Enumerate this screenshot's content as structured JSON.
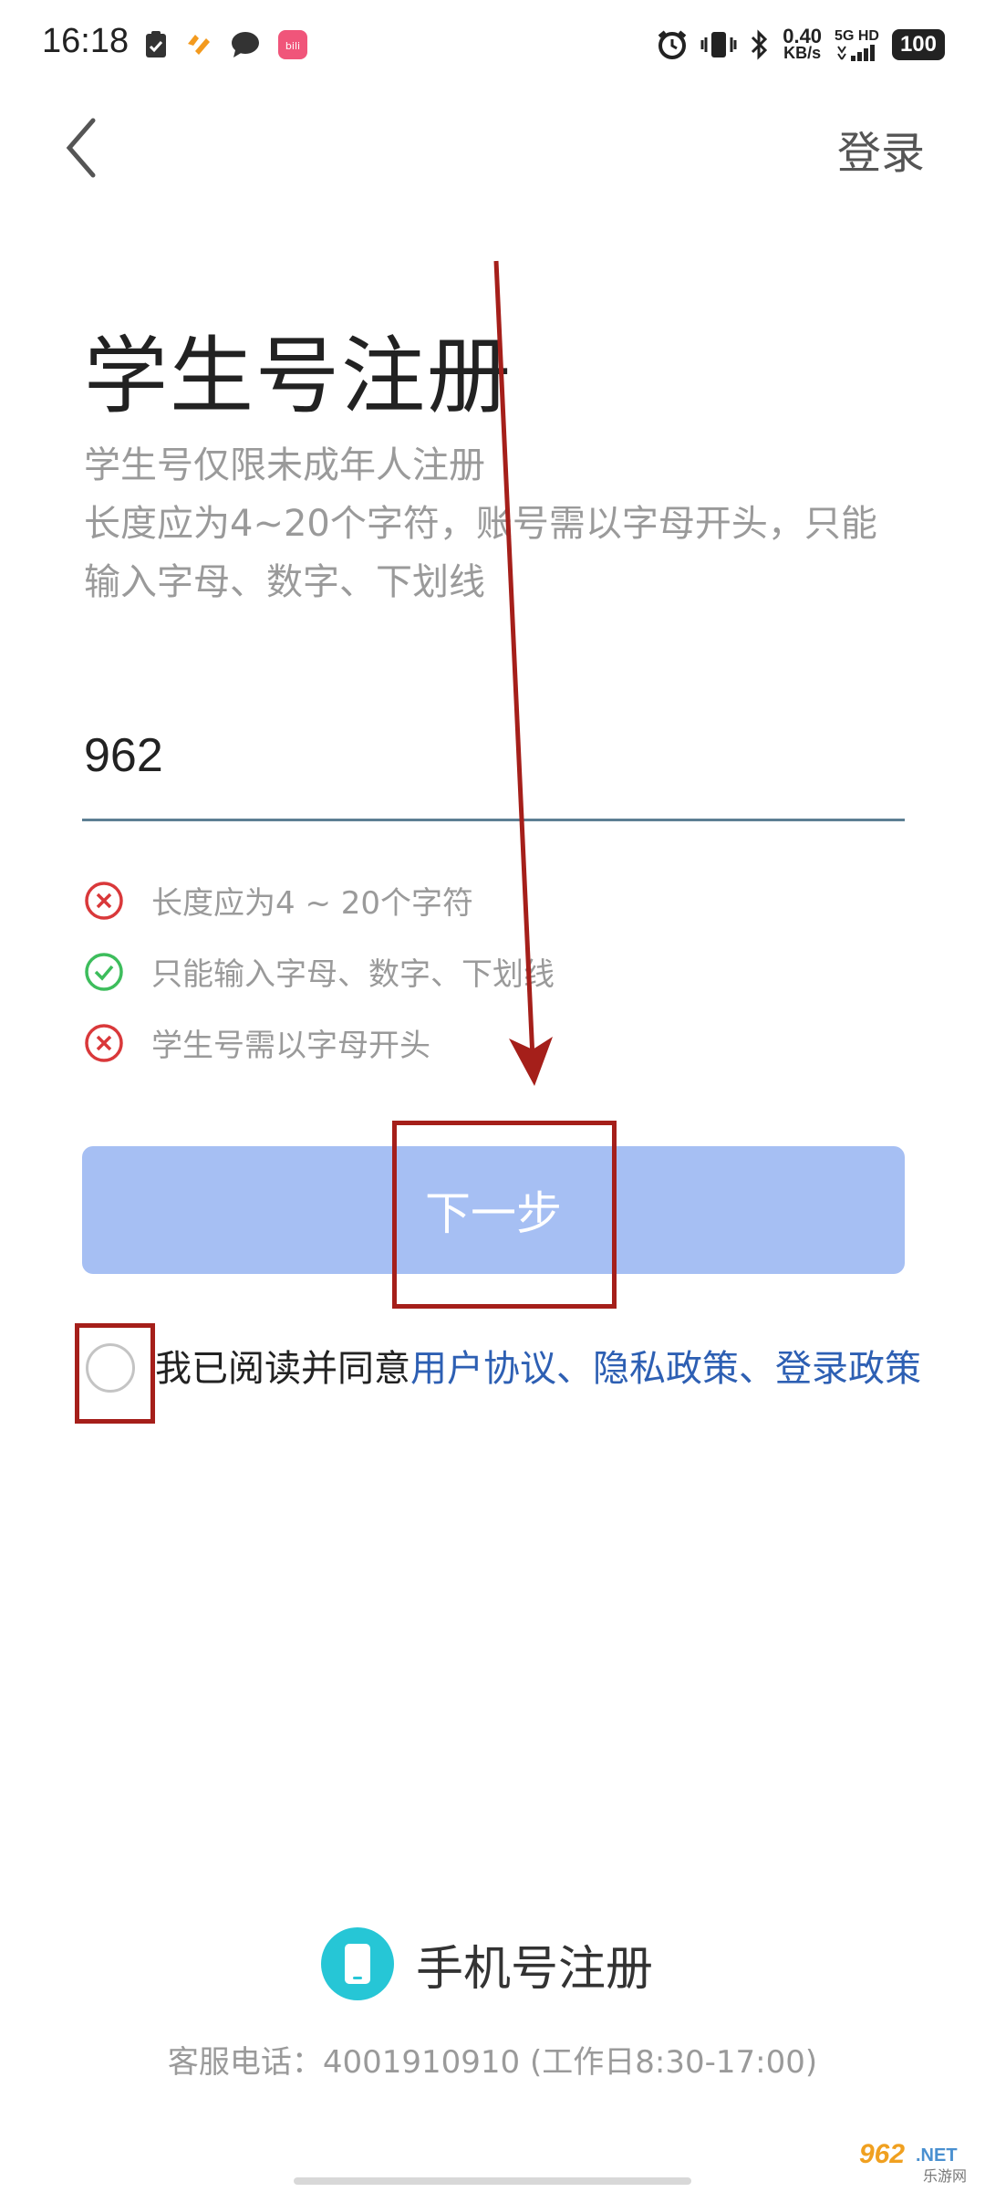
{
  "status_bar": {
    "time": "16:18",
    "net_speed_value": "0.40",
    "net_speed_unit": "KB/s",
    "network_type": "5G HD",
    "battery": "100",
    "icons": [
      "clipboard-check-icon",
      "app-notification-icon",
      "chat-bubble-icon",
      "app-badge-icon",
      "alarm-icon",
      "vibrate-icon",
      "bluetooth-icon",
      "signal-icon"
    ]
  },
  "header": {
    "back_icon": "chevron-left-icon",
    "login_label": "登录"
  },
  "page": {
    "title": "学生号注册",
    "description_line1": "学生号仅限未成年人注册",
    "description_line2": "长度应为4~20个字符，账号需以字母开头，只能",
    "description_line3": "输入字母、数字、下划线"
  },
  "form": {
    "account_value": "962",
    "rules": [
      {
        "text": "长度应为4 ~ 20个字符",
        "status": "fail"
      },
      {
        "text": "只能输入字母、数字、下划线",
        "status": "pass"
      },
      {
        "text": "学生号需以字母开头",
        "status": "fail"
      }
    ],
    "next_label": "下一步",
    "agree_checked": false,
    "agree_prefix": "我已阅读并同意",
    "link_user_agreement": "用户协议",
    "separator": "、",
    "link_privacy": "隐私政策",
    "link_login_policy": "登录政策"
  },
  "footer": {
    "phone_register_label": "手机号注册",
    "service_phone": "客服电话：4001910910 (工作日8:30-17:00)"
  },
  "watermark": {
    "text": "962.NET",
    "subtext": "乐游网"
  },
  "colors": {
    "primary_button": "#a6bff3",
    "link": "#2d5fb3",
    "fail": "#d9383a",
    "pass": "#3dbd5c",
    "phone_icon_bg": "#26c6d6",
    "annotation": "#a51f1a"
  }
}
